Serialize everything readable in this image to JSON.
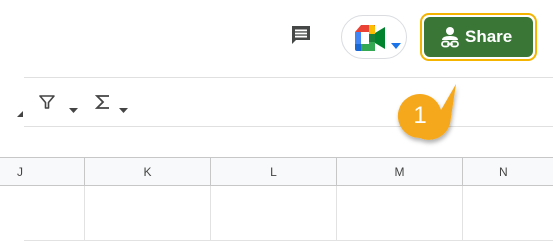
{
  "header": {
    "comment_icon": "comment-icon",
    "meet_icon": "google-meet-icon",
    "share": {
      "label": "Share",
      "icon": "person-link-icon",
      "color": "#3a7737",
      "highlight": "#f4b400"
    }
  },
  "toolbar": {
    "filter_icon": "filter-icon",
    "functions_icon": "sigma-icon"
  },
  "callout": {
    "number": "1",
    "color": "#f6a81d"
  },
  "columns": [
    "J",
    "K",
    "L",
    "M",
    "N"
  ]
}
